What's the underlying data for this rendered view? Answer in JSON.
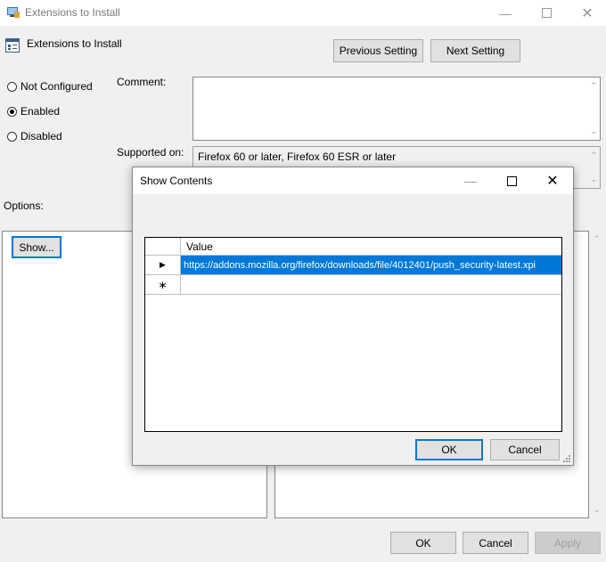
{
  "window": {
    "title": "Extensions to Install",
    "setting_name": "Extensions to Install"
  },
  "nav": {
    "previous": "Previous Setting",
    "next": "Next Setting"
  },
  "state": {
    "options": [
      {
        "label": "Not Configured",
        "selected": false
      },
      {
        "label": "Enabled",
        "selected": true
      },
      {
        "label": "Disabled",
        "selected": false
      }
    ]
  },
  "labels": {
    "comment": "Comment:",
    "supported_on": "Supported on:",
    "options": "Options:"
  },
  "supported_on_value": "Firefox 60 or later, Firefox 60 ESR or later",
  "show_button": "Show...",
  "footer": {
    "ok": "OK",
    "cancel": "Cancel",
    "apply": "Apply"
  },
  "dialog": {
    "title": "Show Contents",
    "column_header": "Value",
    "rows": [
      {
        "value": "https://addons.mozilla.org/firefox/downloads/file/4012401/push_security-latest.xpi"
      }
    ],
    "ok": "OK",
    "cancel": "Cancel"
  },
  "colors": {
    "accent": "#0078d7",
    "selection": "#0078d7"
  },
  "icons": {
    "app": "policy-editor-icon",
    "setting": "policy-setting-icon",
    "current_row": "row-pointer-icon",
    "new_row": "new-row-asterisk-icon"
  }
}
